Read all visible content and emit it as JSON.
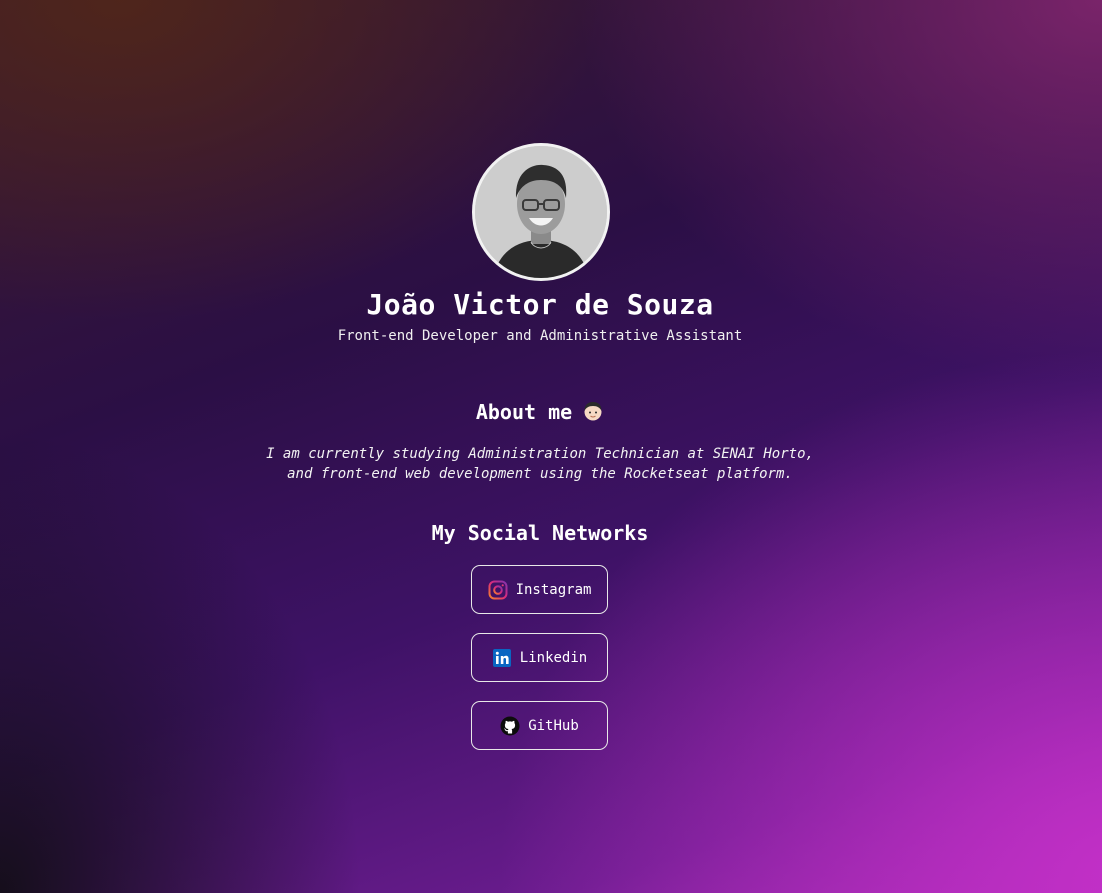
{
  "profile": {
    "name": "João Victor de Souza",
    "role": "Front-end Developer and Administrative Assistant"
  },
  "about": {
    "title": "About me",
    "emoji_icon": "boy-face-icon",
    "line1": "I am currently studying Administration Technician at SENAI Horto,",
    "line2": "and front-end web development using the Rocketseat platform."
  },
  "social": {
    "title": "My Social Networks",
    "links": [
      {
        "label": "Instagram",
        "icon": "instagram-icon"
      },
      {
        "label": "Linkedin",
        "icon": "linkedin-icon"
      },
      {
        "label": "GitHub",
        "icon": "github-icon"
      }
    ]
  },
  "colors": {
    "linkedin": "#0a66c2",
    "instagram_start": "#f58529",
    "instagram_end": "#8134af",
    "border": "#e8e8e8"
  }
}
